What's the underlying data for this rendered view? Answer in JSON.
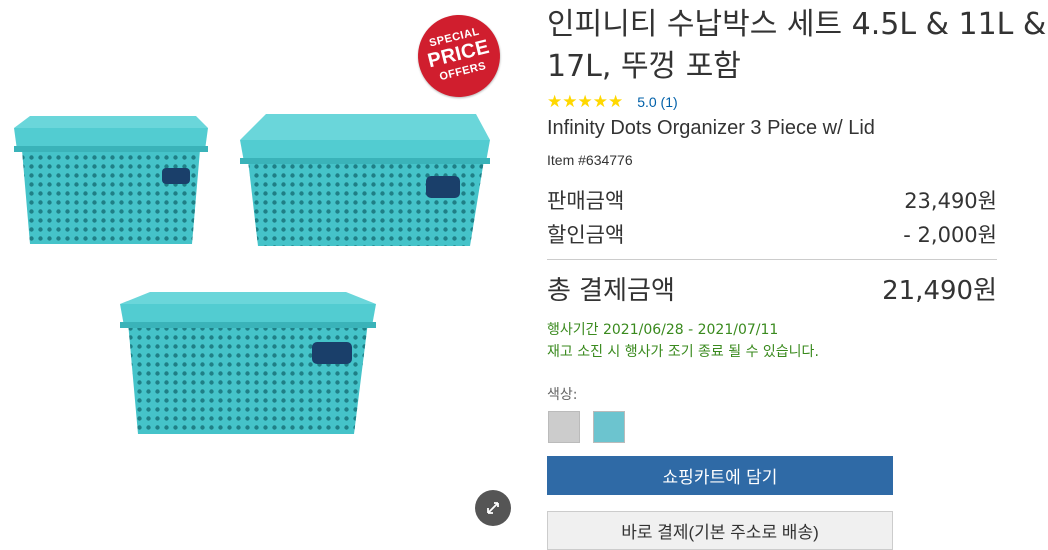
{
  "badge": {
    "line1": "SPECIAL",
    "line2": "PRICE",
    "line3": "OFFERS"
  },
  "product": {
    "title": "인피니티 수납박스 세트 4.5L & 11L & 17L, 뚜껑 포함",
    "stars": "★★★★★",
    "rating_text": "5.0 (1)",
    "english_name": "Infinity Dots Organizer 3 Piece w/ Lid",
    "item_number": "Item #634776"
  },
  "pricing": {
    "sale_label": "판매금액",
    "sale_value": "23,490원",
    "discount_label": "할인금액",
    "discount_value": "- 2,000원",
    "total_label": "총 결제금액",
    "total_value": "21,490원"
  },
  "promo": {
    "period": "행사기간 2021/06/28 - 2021/07/11",
    "notice": "재고 소진 시 행사가 조기 종료 될 수 있습니다."
  },
  "options": {
    "color_label": "색상:",
    "swatches": [
      "#cccccc",
      "#6cc4cf"
    ]
  },
  "buttons": {
    "add_to_cart": "쇼핑카트에 담기",
    "buy_now": "바로 결제(기본 주소로 배송)"
  },
  "colors": {
    "accent_blue": "#2f6aa6",
    "promo_green": "#3a8a1e",
    "badge_red": "#d01e2e",
    "box_teal": "#3fbfc5"
  }
}
